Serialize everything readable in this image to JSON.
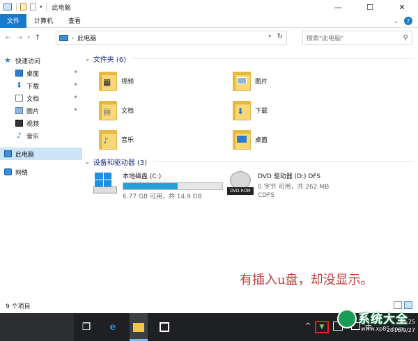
{
  "window": {
    "title": "此电脑",
    "controls": {
      "minimize": "—",
      "maximize": "☐",
      "close": "✕"
    }
  },
  "ribbon": {
    "tabs": [
      "文件",
      "计算机",
      "查看"
    ]
  },
  "address": {
    "location": "此电脑",
    "search_placeholder": "搜索\"此电脑\""
  },
  "nav_pane": {
    "quick_access": "快速访问",
    "items": [
      {
        "label": "桌面",
        "icon": "desktop-icon",
        "pinned": true
      },
      {
        "label": "下载",
        "icon": "download-icon",
        "pinned": true
      },
      {
        "label": "文档",
        "icon": "document-icon",
        "pinned": true
      },
      {
        "label": "图片",
        "icon": "picture-icon",
        "pinned": true
      },
      {
        "label": "视频",
        "icon": "video-icon",
        "pinned": false
      },
      {
        "label": "音乐",
        "icon": "music-icon",
        "pinned": false
      }
    ],
    "this_pc": "此电脑",
    "network": "网络"
  },
  "content": {
    "folders_header": "文件夹 (6)",
    "folders": [
      {
        "name": "视频",
        "icon": "video-folder-icon"
      },
      {
        "name": "图片",
        "icon": "pictures-folder-icon"
      },
      {
        "name": "文档",
        "icon": "documents-folder-icon"
      },
      {
        "name": "下载",
        "icon": "downloads-folder-icon"
      },
      {
        "name": "音乐",
        "icon": "music-folder-icon"
      },
      {
        "name": "桌面",
        "icon": "desktop-folder-icon"
      }
    ],
    "drives_header": "设备和驱动器 (3)",
    "drives": [
      {
        "name": "本地磁盘 (C:)",
        "free": "6.77 GB 可用，共 14.9 GB",
        "used_fraction": 0.55,
        "icon": "hard-disk-icon"
      },
      {
        "name": "DVD 驱动器 (D:) DFS",
        "free": "0 字节 可用，共 262 MB",
        "fs": "CDFS",
        "disc_label": "DVD-ROM",
        "icon": "dvd-drive-icon"
      }
    ]
  },
  "annotation": "有插入u盘，却没显示。",
  "status": {
    "item_count": "9 个项目"
  },
  "taskbar": {
    "tray_ime": "中",
    "time": "9:25",
    "date": "2016/9/27"
  },
  "watermark": {
    "text": "系统大全",
    "sub": "www.xp85.com"
  }
}
